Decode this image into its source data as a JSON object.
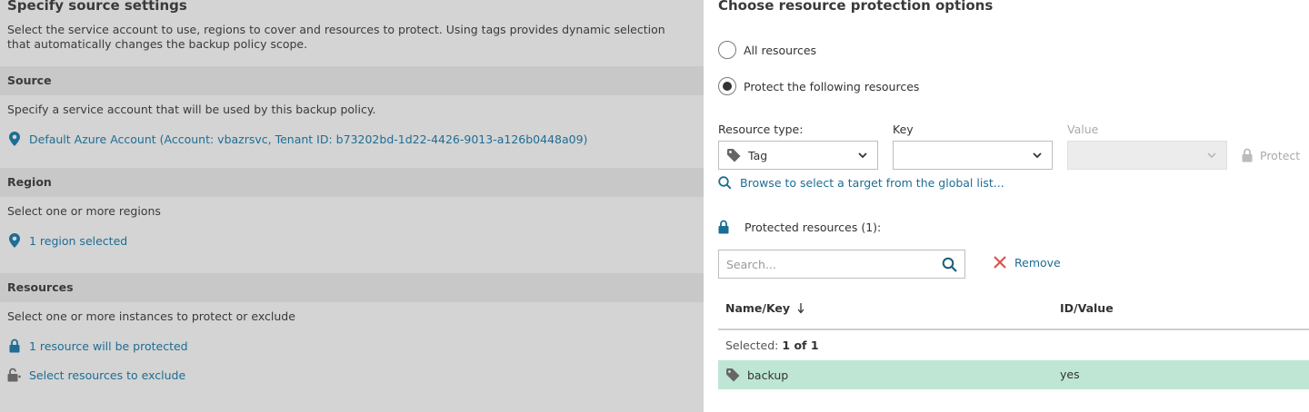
{
  "left": {
    "title": "Specify source settings",
    "description": "Select the service account to use, regions to cover and resources to protect. Using tags provides dynamic selection that automatically changes the backup policy scope.",
    "source": {
      "heading": "Source",
      "text": "Specify a service account that will be used by this backup policy.",
      "link": "Default Azure Account (Account: vbazrsvc, Tenant ID: b73202bd-1d22-4426-9013-a126b0448a09)"
    },
    "region": {
      "heading": "Region",
      "text": "Select one or more regions",
      "link": "1 region selected"
    },
    "resources": {
      "heading": "Resources",
      "text": "Select one or more instances to protect or exclude",
      "link_protected": "1 resource will be protected",
      "link_exclude": "Select resources to exclude"
    }
  },
  "right": {
    "title": "Choose resource protection options",
    "radio_all": "All resources",
    "radio_following": "Protect the following resources",
    "selected_option": "Protect the following resources",
    "resource_type_label": "Resource type:",
    "resource_type_value": "Tag",
    "key_label": "Key",
    "key_value": "",
    "value_label": "Value",
    "value_value": "",
    "protect_label": "Protect",
    "browse_link": "Browse to select a target from the global list...",
    "protected_resources": "Protected resources (1):",
    "search_placeholder": "Search...",
    "remove_label": "Remove",
    "table": {
      "col_name": "Name/Key",
      "col_id": "ID/Value",
      "selected_label": "Selected:",
      "selected_value": "1 of 1",
      "rows": [
        {
          "name": "backup",
          "value": "yes"
        }
      ]
    }
  },
  "colors": {
    "link": "#1e6d94",
    "row_selected": "#bfe6d4",
    "remove_x": "#d9534f",
    "overlay_bg": "#d4d4d4"
  }
}
